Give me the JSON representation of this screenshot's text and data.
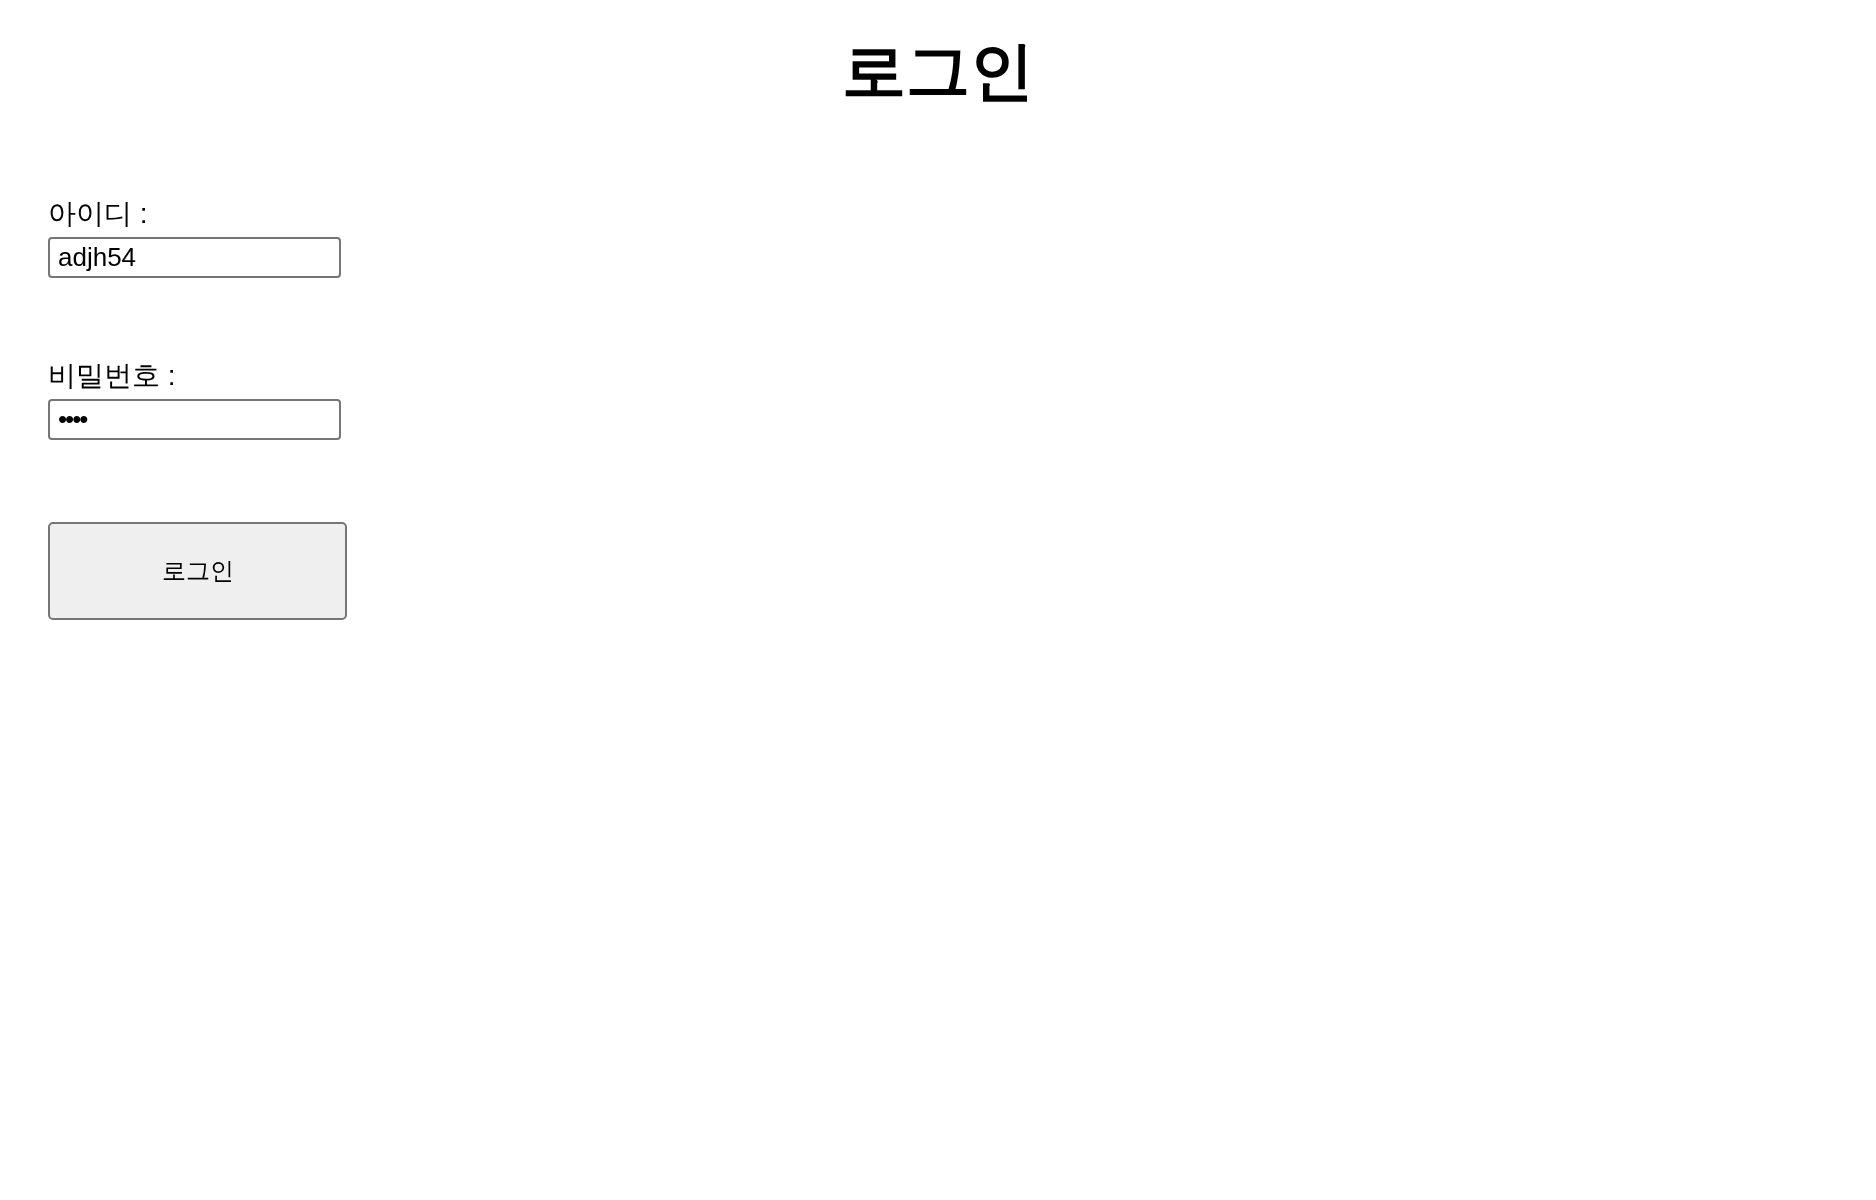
{
  "title": "로그인",
  "fields": [
    {
      "kind": "text",
      "label": "아이디 :",
      "value": "adjh54"
    },
    {
      "kind": "password",
      "label": "비밀번호 :",
      "value": "••••"
    }
  ],
  "submit_button": "로그인"
}
